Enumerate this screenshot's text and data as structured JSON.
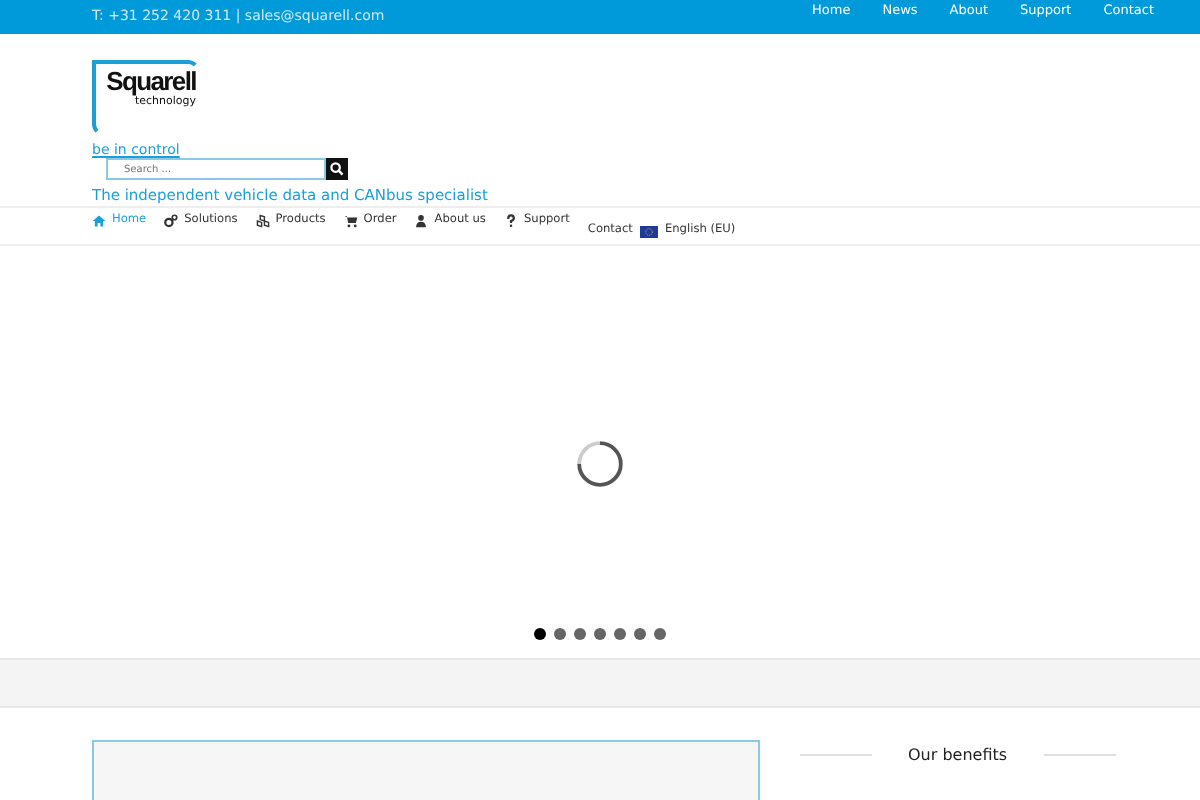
{
  "topbar": {
    "contact": "T: +31 252 420 311 | sales@squarell.com",
    "links": [
      {
        "label": "Home"
      },
      {
        "label": "News"
      },
      {
        "label": "About"
      },
      {
        "label": "Support"
      },
      {
        "label": "Contact"
      }
    ]
  },
  "logo": {
    "name": "Squarell",
    "sub": "technology"
  },
  "slogan": "be in control",
  "search": {
    "placeholder": "Search ..."
  },
  "tagline": "The independent vehicle data and CANbus specialist",
  "nav": [
    {
      "label": "Home",
      "kind": "home",
      "selected": true
    },
    {
      "label": "Solutions",
      "kind": "cogs",
      "selected": false
    },
    {
      "label": "Products",
      "kind": "cubes",
      "selected": false
    },
    {
      "label": "Order",
      "kind": "cart",
      "selected": false
    },
    {
      "label": "About us",
      "kind": "user",
      "selected": false
    },
    {
      "label": "Support",
      "kind": "question",
      "selected": false
    }
  ],
  "nav_extra": {
    "contact": "Contact",
    "language": "English (EU)"
  },
  "slider": {
    "dots": [
      {
        "selected": true
      },
      {
        "selected": false
      },
      {
        "selected": false
      },
      {
        "selected": false
      },
      {
        "selected": false
      },
      {
        "selected": false
      },
      {
        "selected": false
      }
    ]
  },
  "sidebar": {
    "title": "Our benefits"
  }
}
